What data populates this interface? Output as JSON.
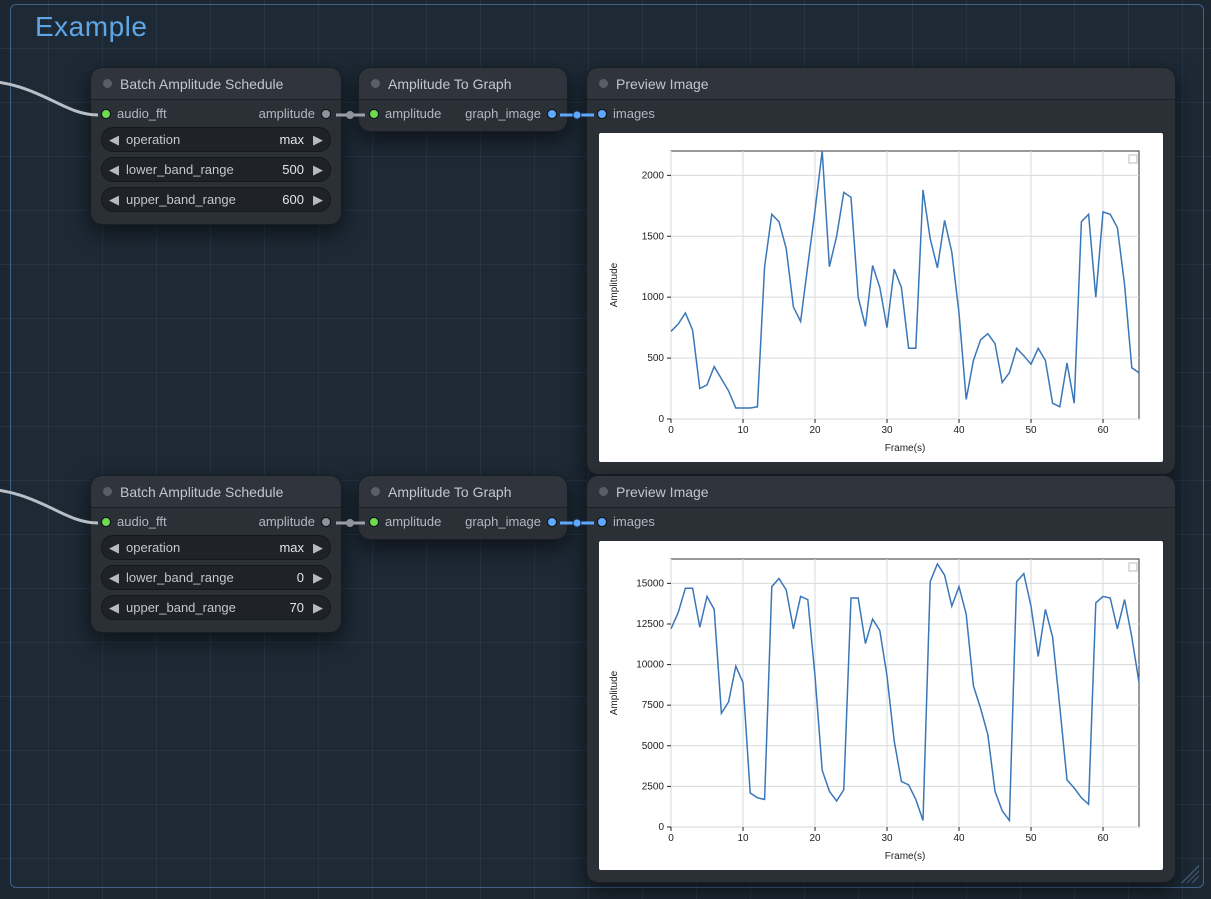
{
  "group": {
    "title": "Example"
  },
  "rows": [
    {
      "bas": {
        "title": "Batch Amplitude Schedule",
        "input_label": "audio_fft",
        "output_label": "amplitude",
        "params": [
          {
            "name": "operation",
            "value": "max"
          },
          {
            "name": "lower_band_range",
            "value": "500"
          },
          {
            "name": "upper_band_range",
            "value": "600"
          }
        ]
      },
      "a2g": {
        "title": "Amplitude To Graph",
        "input_label": "amplitude",
        "output_label": "graph_image"
      },
      "preview": {
        "title": "Preview Image",
        "input_label": "images"
      },
      "chart": {
        "type": "line",
        "xlabel": "Frame(s)",
        "ylabel": "Amplitude",
        "xlim": [
          0,
          65
        ],
        "ylim": [
          0,
          2200
        ],
        "xticks": [
          0,
          10,
          20,
          30,
          40,
          50,
          60
        ],
        "yticks": [
          0,
          500,
          1000,
          1500,
          2000
        ],
        "x": [
          0,
          1,
          2,
          3,
          4,
          5,
          6,
          7,
          8,
          9,
          10,
          11,
          12,
          13,
          14,
          15,
          16,
          17,
          18,
          19,
          20,
          21,
          22,
          23,
          24,
          25,
          26,
          27,
          28,
          29,
          30,
          31,
          32,
          33,
          34,
          35,
          36,
          37,
          38,
          39,
          40,
          41,
          42,
          43,
          44,
          45,
          46,
          47,
          48,
          49,
          50,
          51,
          52,
          53,
          54,
          55,
          56,
          57,
          58,
          59,
          60,
          61,
          62,
          63,
          64,
          65
        ],
        "y": [
          720,
          780,
          870,
          730,
          250,
          280,
          430,
          330,
          230,
          90,
          90,
          90,
          100,
          1250,
          1680,
          1620,
          1400,
          920,
          800,
          1260,
          1710,
          2200,
          1250,
          1500,
          1860,
          1820,
          1000,
          760,
          1260,
          1080,
          750,
          1230,
          1080,
          580,
          580,
          1880,
          1480,
          1240,
          1630,
          1370,
          870,
          160,
          480,
          650,
          700,
          620,
          300,
          380,
          580,
          520,
          450,
          580,
          480,
          130,
          100,
          460,
          130,
          1620,
          1680,
          1000,
          1700,
          1680,
          1570,
          1100,
          420,
          380
        ]
      }
    },
    {
      "bas": {
        "title": "Batch Amplitude Schedule",
        "input_label": "audio_fft",
        "output_label": "amplitude",
        "params": [
          {
            "name": "operation",
            "value": "max"
          },
          {
            "name": "lower_band_range",
            "value": "0"
          },
          {
            "name": "upper_band_range",
            "value": "70"
          }
        ]
      },
      "a2g": {
        "title": "Amplitude To Graph",
        "input_label": "amplitude",
        "output_label": "graph_image"
      },
      "preview": {
        "title": "Preview Image",
        "input_label": "images"
      },
      "chart": {
        "type": "line",
        "xlabel": "Frame(s)",
        "ylabel": "Amplitude",
        "xlim": [
          0,
          65
        ],
        "ylim": [
          0,
          16500
        ],
        "xticks": [
          0,
          10,
          20,
          30,
          40,
          50,
          60
        ],
        "yticks": [
          0,
          2500,
          5000,
          7500,
          10000,
          12500,
          15000
        ],
        "x": [
          0,
          1,
          2,
          3,
          4,
          5,
          6,
          7,
          8,
          9,
          10,
          11,
          12,
          13,
          14,
          15,
          16,
          17,
          18,
          19,
          20,
          21,
          22,
          23,
          24,
          25,
          26,
          27,
          28,
          29,
          30,
          31,
          32,
          33,
          34,
          35,
          36,
          37,
          38,
          39,
          40,
          41,
          42,
          43,
          44,
          45,
          46,
          47,
          48,
          49,
          50,
          51,
          52,
          53,
          54,
          55,
          56,
          57,
          58,
          59,
          60,
          61,
          62,
          63,
          64,
          65
        ],
        "y": [
          12200,
          13200,
          14700,
          14700,
          12300,
          14200,
          13400,
          7000,
          7700,
          9900,
          8900,
          2100,
          1800,
          1700,
          14800,
          15300,
          14600,
          12200,
          14200,
          14000,
          9300,
          3500,
          2200,
          1600,
          2300,
          14100,
          14100,
          11300,
          12800,
          12100,
          9300,
          5300,
          2800,
          2600,
          1700,
          400,
          15100,
          16200,
          15500,
          13600,
          14800,
          13100,
          8700,
          7300,
          5700,
          2200,
          1000,
          400,
          15100,
          15600,
          13600,
          10500,
          13400,
          11700,
          7400,
          2900,
          2400,
          1800,
          1400,
          13800,
          14200,
          14100,
          12200,
          14000,
          11700,
          8900
        ]
      }
    }
  ],
  "chart_data": [
    {
      "type": "line",
      "xlabel": "Frame(s)",
      "ylabel": "Amplitude",
      "xlim": [
        0,
        65
      ],
      "ylim": [
        0,
        2200
      ],
      "series": [
        {
          "name": "amplitude",
          "x": "rows.0.chart.x",
          "y": "rows.0.chart.y"
        }
      ]
    },
    {
      "type": "line",
      "xlabel": "Frame(s)",
      "ylabel": "Amplitude",
      "xlim": [
        0,
        65
      ],
      "ylim": [
        0,
        16500
      ],
      "series": [
        {
          "name": "amplitude",
          "x": "rows.1.chart.x",
          "y": "rows.1.chart.y"
        }
      ]
    }
  ]
}
